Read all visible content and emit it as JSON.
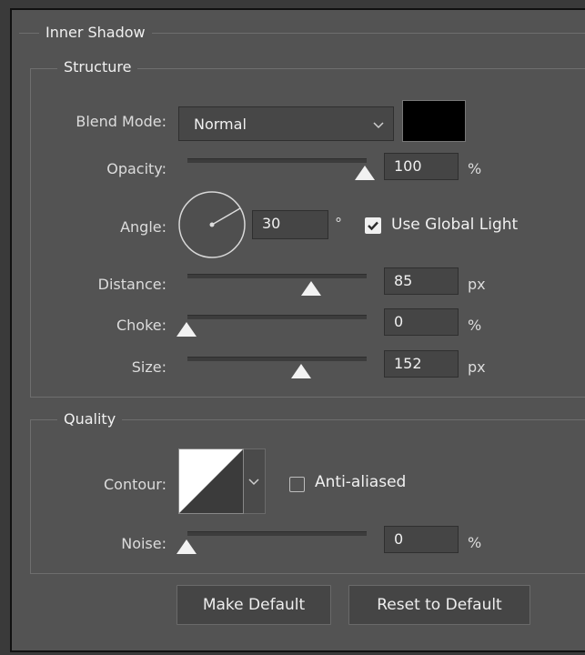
{
  "panel": {
    "title": "Inner Shadow",
    "structure_title": "Structure",
    "quality_title": "Quality"
  },
  "structure": {
    "blend_mode_label": "Blend Mode:",
    "blend_mode_value": "Normal",
    "blend_color": "#000000",
    "opacity_label": "Opacity:",
    "opacity_value": "100",
    "opacity_unit": "%",
    "opacity_level": 1.0,
    "angle_label": "Angle:",
    "angle_value": "30",
    "angle_unit": "°",
    "use_global_light_label": "Use Global Light",
    "use_global_light_checked": true,
    "distance_label": "Distance:",
    "distance_value": "85",
    "distance_unit": "px",
    "distance_level": 0.7,
    "choke_label": "Choke:",
    "choke_value": "0",
    "choke_unit": "%",
    "choke_level": 0.0,
    "size_label": "Size:",
    "size_value": "152",
    "size_unit": "px",
    "size_level": 0.64
  },
  "quality": {
    "contour_label": "Contour:",
    "anti_aliased_label": "Anti-aliased",
    "anti_aliased_checked": false,
    "noise_label": "Noise:",
    "noise_value": "0",
    "noise_unit": "%",
    "noise_level": 0.0
  },
  "buttons": {
    "make_default": "Make Default",
    "reset_default": "Reset to Default"
  }
}
